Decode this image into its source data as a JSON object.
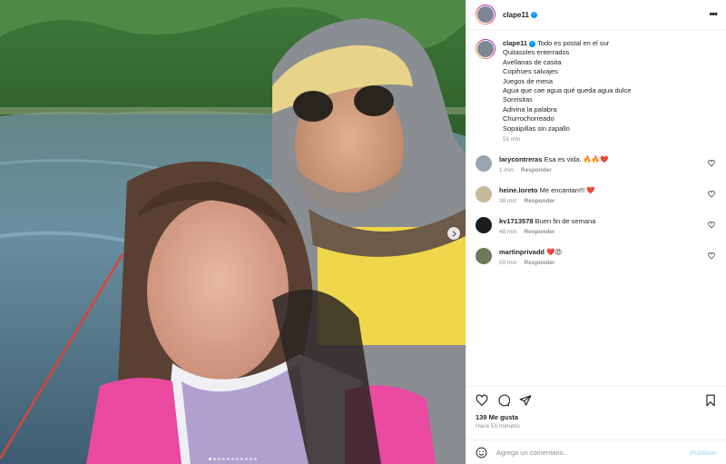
{
  "post": {
    "username": "clape11",
    "verified": true
  },
  "caption": {
    "username": "clape11",
    "first_line": "Todo es postal en el sur",
    "lines": [
      "Quitasoles enterrados",
      "Avellanas de casita",
      "Copihues salvajes",
      "Juegos de mesa",
      "Agua que cae agua qué queda agua dulce",
      "Sonrisitas",
      "Adivina la palabra",
      "Churrochorreado",
      "Sopaipillas sin zapallo"
    ],
    "time": "51 min"
  },
  "comments": [
    {
      "username": "larycontreras",
      "text": "Esa es vida. 🔥🔥❤️",
      "time": "1 min",
      "reply": "Responder",
      "avatar_color": "#9aa5b1"
    },
    {
      "username": "heine.loreto",
      "text": "Me encantan!!! ❤️",
      "time": "38 min",
      "reply": "Responder",
      "avatar_color": "#c7b99a"
    },
    {
      "username": "kv1713578",
      "text": "Buen fin de semana",
      "time": "48 min",
      "reply": "Responder",
      "avatar_color": "#1d1d1d"
    },
    {
      "username": "martinprivadd",
      "text": "❤️😍",
      "time": "50 min",
      "reply": "Responder",
      "avatar_color": "#6b7a5c"
    }
  ],
  "likes": "139 Me gusta",
  "time_ago": "Hace 51 minutos",
  "add_comment": {
    "placeholder": "Agrega un comentario...",
    "post_label": "Publicar"
  },
  "carousel": {
    "count": 11,
    "active": 0
  },
  "icons": {
    "like": "heart-icon",
    "comment": "comment-icon",
    "share": "share-icon",
    "save": "bookmark-icon",
    "emoji": "emoji-icon",
    "more": "more-options-icon",
    "next": "chevron-right-icon"
  },
  "colors": {
    "accent": "#0095f6",
    "post_button": "#b2dffc",
    "muted": "#8e8e8e"
  }
}
